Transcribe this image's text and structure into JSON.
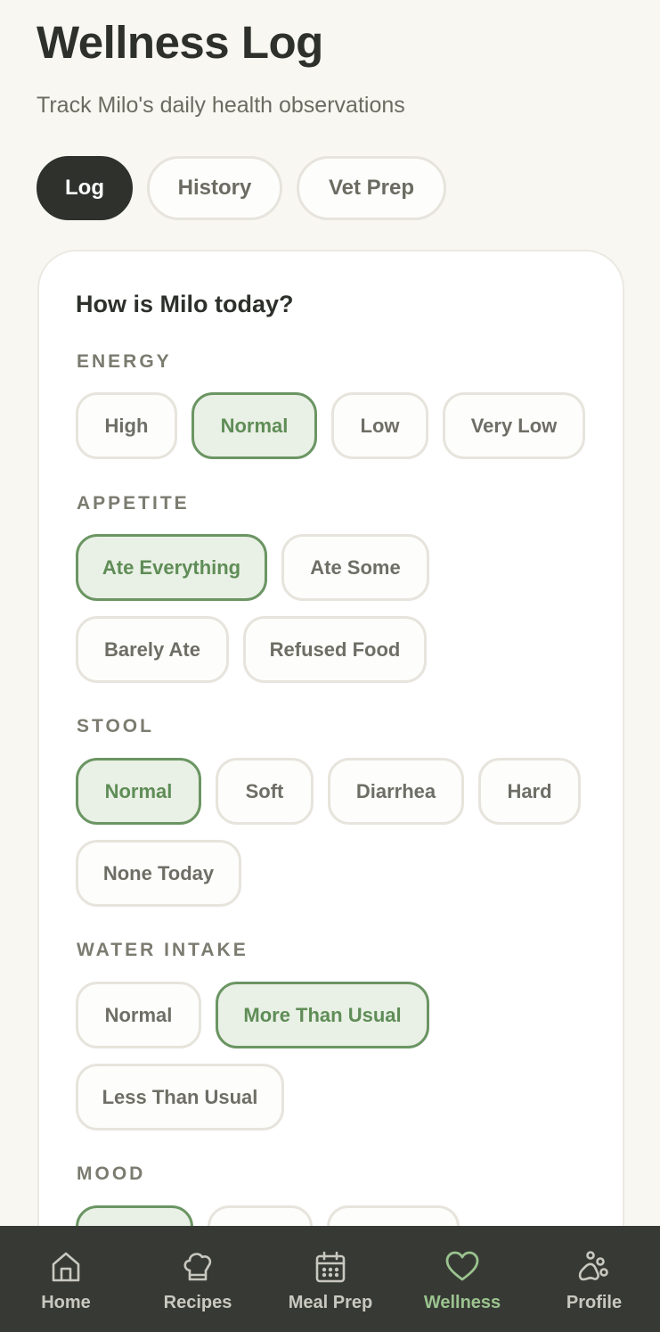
{
  "header": {
    "title": "Wellness Log",
    "subtitle": "Track Milo's daily health observations"
  },
  "tabs": [
    {
      "label": "Log",
      "active": true
    },
    {
      "label": "History",
      "active": false
    },
    {
      "label": "Vet Prep",
      "active": false
    }
  ],
  "card": {
    "heading": "How is Milo today?",
    "sections": {
      "energy": {
        "label": "ENERGY",
        "selected": "Normal",
        "options": [
          "High",
          "Normal",
          "Low",
          "Very Low"
        ]
      },
      "appetite": {
        "label": "APPETITE",
        "selected": "Ate Everything",
        "options": [
          "Ate Everything",
          "Ate Some",
          "Barely Ate",
          "Refused Food"
        ]
      },
      "stool": {
        "label": "STOOL",
        "selected": "Normal",
        "options": [
          "Normal",
          "Soft",
          "Diarrhea",
          "Hard",
          "None Today"
        ]
      },
      "water": {
        "label": "WATER INTAKE",
        "selected": "More Than Usual",
        "options": [
          "Normal",
          "More Than Usual",
          "Less Than Usual"
        ]
      },
      "mood": {
        "label": "MOOD"
      }
    }
  },
  "bottom_nav": {
    "items": [
      {
        "label": "Home",
        "icon": "home-icon",
        "active": false
      },
      {
        "label": "Recipes",
        "icon": "chef-hat-icon",
        "active": false
      },
      {
        "label": "Meal Prep",
        "icon": "calendar-icon",
        "active": false
      },
      {
        "label": "Wellness",
        "icon": "heart-icon",
        "active": true
      },
      {
        "label": "Profile",
        "icon": "paw-icon",
        "active": false
      }
    ]
  },
  "colors": {
    "accent_green": "#6b9563",
    "selected_fill": "#e9f0e5",
    "dark": "#2e312c",
    "nav_active": "#9bc38f"
  }
}
